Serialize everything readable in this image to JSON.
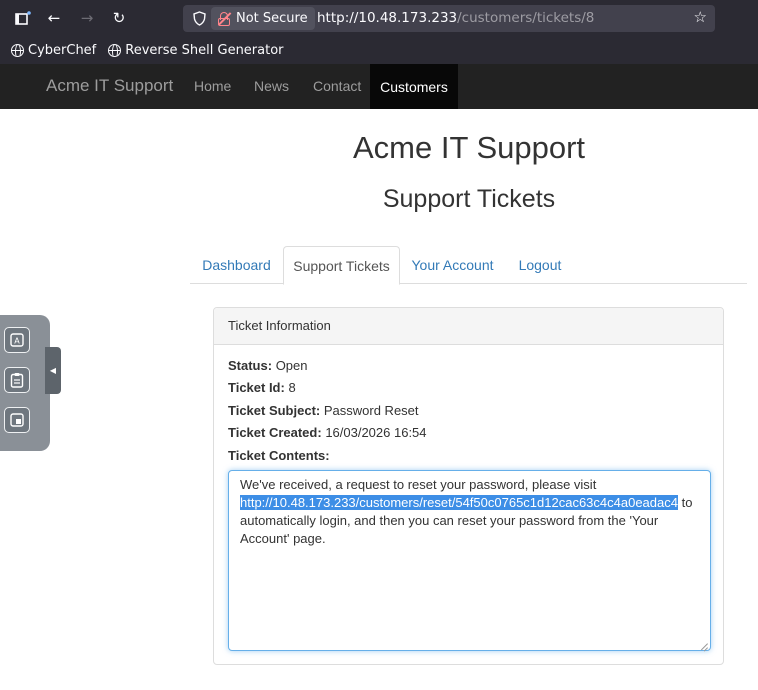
{
  "browser": {
    "url_host": "http://10.48.173.233",
    "url_path": "/customers/tickets/8",
    "security_label": "Not Secure",
    "bookmarks": [
      {
        "label": "CyberChef"
      },
      {
        "label": "Reverse Shell Generator"
      }
    ],
    "icons": {
      "tabs": "tab-overview-icon",
      "back": "back-arrow-icon",
      "forward": "forward-arrow-icon",
      "reload": "reload-icon",
      "shield": "tracking-shield-icon",
      "lock": "insecure-lock-icon",
      "star": "bookmark-star-icon"
    }
  },
  "navbar": {
    "brand": "Acme IT Support",
    "links": [
      {
        "label": "Home"
      },
      {
        "label": "News"
      },
      {
        "label": "Contact"
      }
    ],
    "active_link": "Customers"
  },
  "page": {
    "site_title": "Acme IT Support",
    "heading": "Support Tickets"
  },
  "tabs": [
    {
      "label": "Dashboard",
      "active": false
    },
    {
      "label": "Support Tickets",
      "active": true
    },
    {
      "label": "Your Account",
      "active": false
    },
    {
      "label": "Logout",
      "active": false
    }
  ],
  "ticket": {
    "panel_title": "Ticket Information",
    "status_label": "Status:",
    "status_value": "Open",
    "id_label": "Ticket Id:",
    "id_value": "8",
    "subject_label": "Ticket Subject:",
    "subject_value": "Password Reset",
    "created_label": "Ticket Created:",
    "created_value": "16/03/2026 16:54",
    "contents_label": "Ticket Contents:",
    "contents_before": "We've received, a request to reset your password, please visit ",
    "contents_link": "http://10.48.173.233/customers/reset/54f50c0765c1d12cac63c4c4a0eadac4",
    "contents_after": " to automatically login, and then you can reset your password from the 'Your Account' page."
  },
  "colors": {
    "navbar_bg": "#222222",
    "link": "#337ab7",
    "selection": "#3d8ee6",
    "focus_border": "#66afe9"
  }
}
